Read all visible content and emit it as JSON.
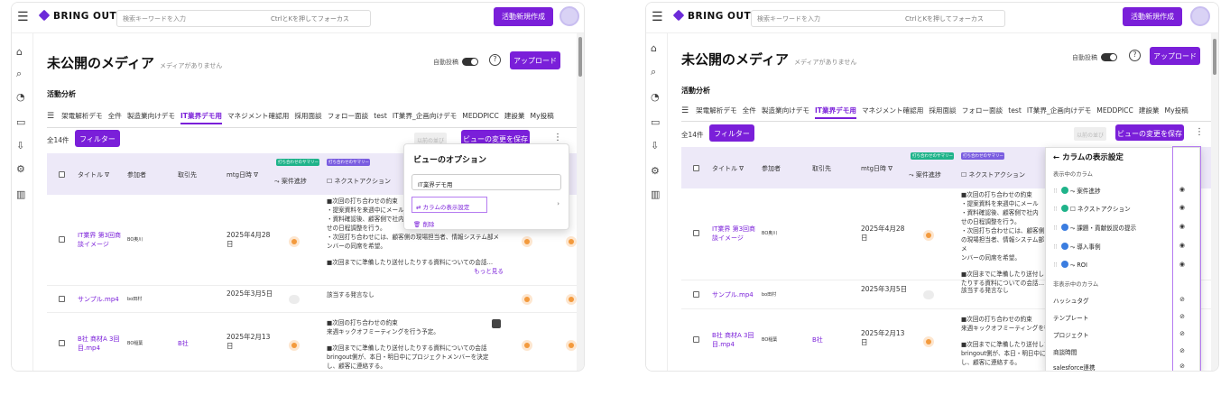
{
  "brand": {
    "logo_text": "BRING OUT",
    "accent": "#7a1fd9"
  },
  "header": {
    "search_placeholder": "検索キーワードを入力",
    "search_hint": "CtrlとKを押してフォーカス",
    "create_label": "活動新規作成"
  },
  "page": {
    "title": "未公開のメディア",
    "subtitle": "メディアがありません",
    "auto_post": "自動投稿",
    "help": "?",
    "upload_label": "アップロード",
    "section": "活動分析",
    "count": "全14件",
    "filter_label": "フィルター",
    "ghost_label": "以前の並び",
    "save_view_label": "ビューの変更を保存",
    "kebab": "⋮"
  },
  "tabs": [
    "架電解析デモ",
    "全件",
    "製造業向けデモ",
    "IT業界デモ用",
    "マネジメント確認用",
    "採用面談",
    "フォロー面談",
    "test",
    "IT業界_企画向けデモ",
    "MEDDPICC",
    "建設業",
    "My投稿"
  ],
  "active_tab": "IT業界デモ用",
  "columns": {
    "title": "タイトル ∇",
    "participants": "参加者",
    "client": "取引先",
    "mtg_date": "mtg日時 ∇",
    "deal_progress": "⤳ 案件進捗",
    "next_action": "☐ ネクストアクション",
    "ai_badge": "打ち合わせのサマリー"
  },
  "rows": [
    {
      "title": "IT業界 第3回商談イメージ",
      "participant": "BO奥川",
      "client": "",
      "date": "2025年4月28日",
      "note_lines": [
        "■次回の打ち合わせの約束",
        "・提案資料を来週中にメール",
        "・資料確認後、顧客側で社内",
        "せの日程調整を行う。",
        "・次回打ち合わせには、顧客側の現場担当者、情報システム部メ",
        "ンバーの同席を希望。",
        "",
        "■次回までに準備したり送付したりする資料についての会話…"
      ],
      "more": "もっと見る"
    },
    {
      "title": "サンプル.mp4",
      "participant": "bo田村",
      "client": "",
      "date": "2025年3月5日",
      "note_lines": [
        "該当する発言なし"
      ],
      "more": ""
    },
    {
      "title": "B社 商材A 3回目.mp4",
      "participant": "BO稲葉",
      "client": "B社",
      "date": "2025年2月13日",
      "note_lines": [
        "■次回の打ち合わせの約束",
        "来週キックオフミーティングを行う予定。",
        "",
        "■次回までに準備したり送付したりする資料についての会話",
        "bringout側が、本日・明日中にプロジェクトメンバーを決定",
        "し、顧客に連絡する。"
      ],
      "more": ""
    }
  ],
  "view_options": {
    "title": "ビューのオプション",
    "name_value": "IT業界デモ用",
    "column_settings": "⇄ カラムの表示設定",
    "delete": "🗑 削除"
  },
  "column_settings_panel": {
    "back_title": "← カラムの表示設定",
    "shown_header": "表示中のカラム",
    "shown": [
      "⤳ 案件進捗",
      "☐ ネクストアクション",
      "⤳ 課題・貢献仮説の提示",
      "⤳ 導入事例",
      "⤳ ROI"
    ],
    "hidden_header": "非表示中のカラム",
    "hidden": [
      "ハッシュタグ",
      "テンプレート",
      "プロジェクト",
      "商談時間",
      "salesforce連携"
    ]
  }
}
